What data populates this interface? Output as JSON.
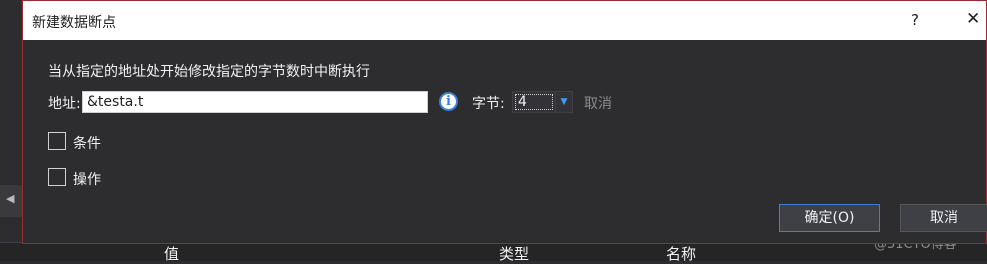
{
  "dialog": {
    "title": "新建数据断点",
    "help_glyph": "?",
    "close_glyph": "✕",
    "description": "当从指定的地址处开始修改指定的字节数时中断执行",
    "address_label": "地址:",
    "address_value": "&testa.t",
    "info_glyph": "i",
    "bytes_label": "字节:",
    "bytes_value": "4",
    "bytes_dropdown_glyph": "▼",
    "cancel_link": "取消",
    "conditions_label": "条件",
    "conditions_checked": false,
    "actions_label": "操作",
    "actions_checked": false,
    "ok_button": "确定(O)",
    "cancel_button": "取消"
  },
  "background": {
    "scroll_arrow": "◀",
    "columns": [
      "值",
      "类型",
      "名称"
    ],
    "watermark": "@51CTO博客"
  },
  "colors": {
    "dialog_bg": "#2d2d30",
    "titlebar_bg": "#ffffff",
    "accent": "#3c7fd6",
    "border": "#9b2a35"
  }
}
